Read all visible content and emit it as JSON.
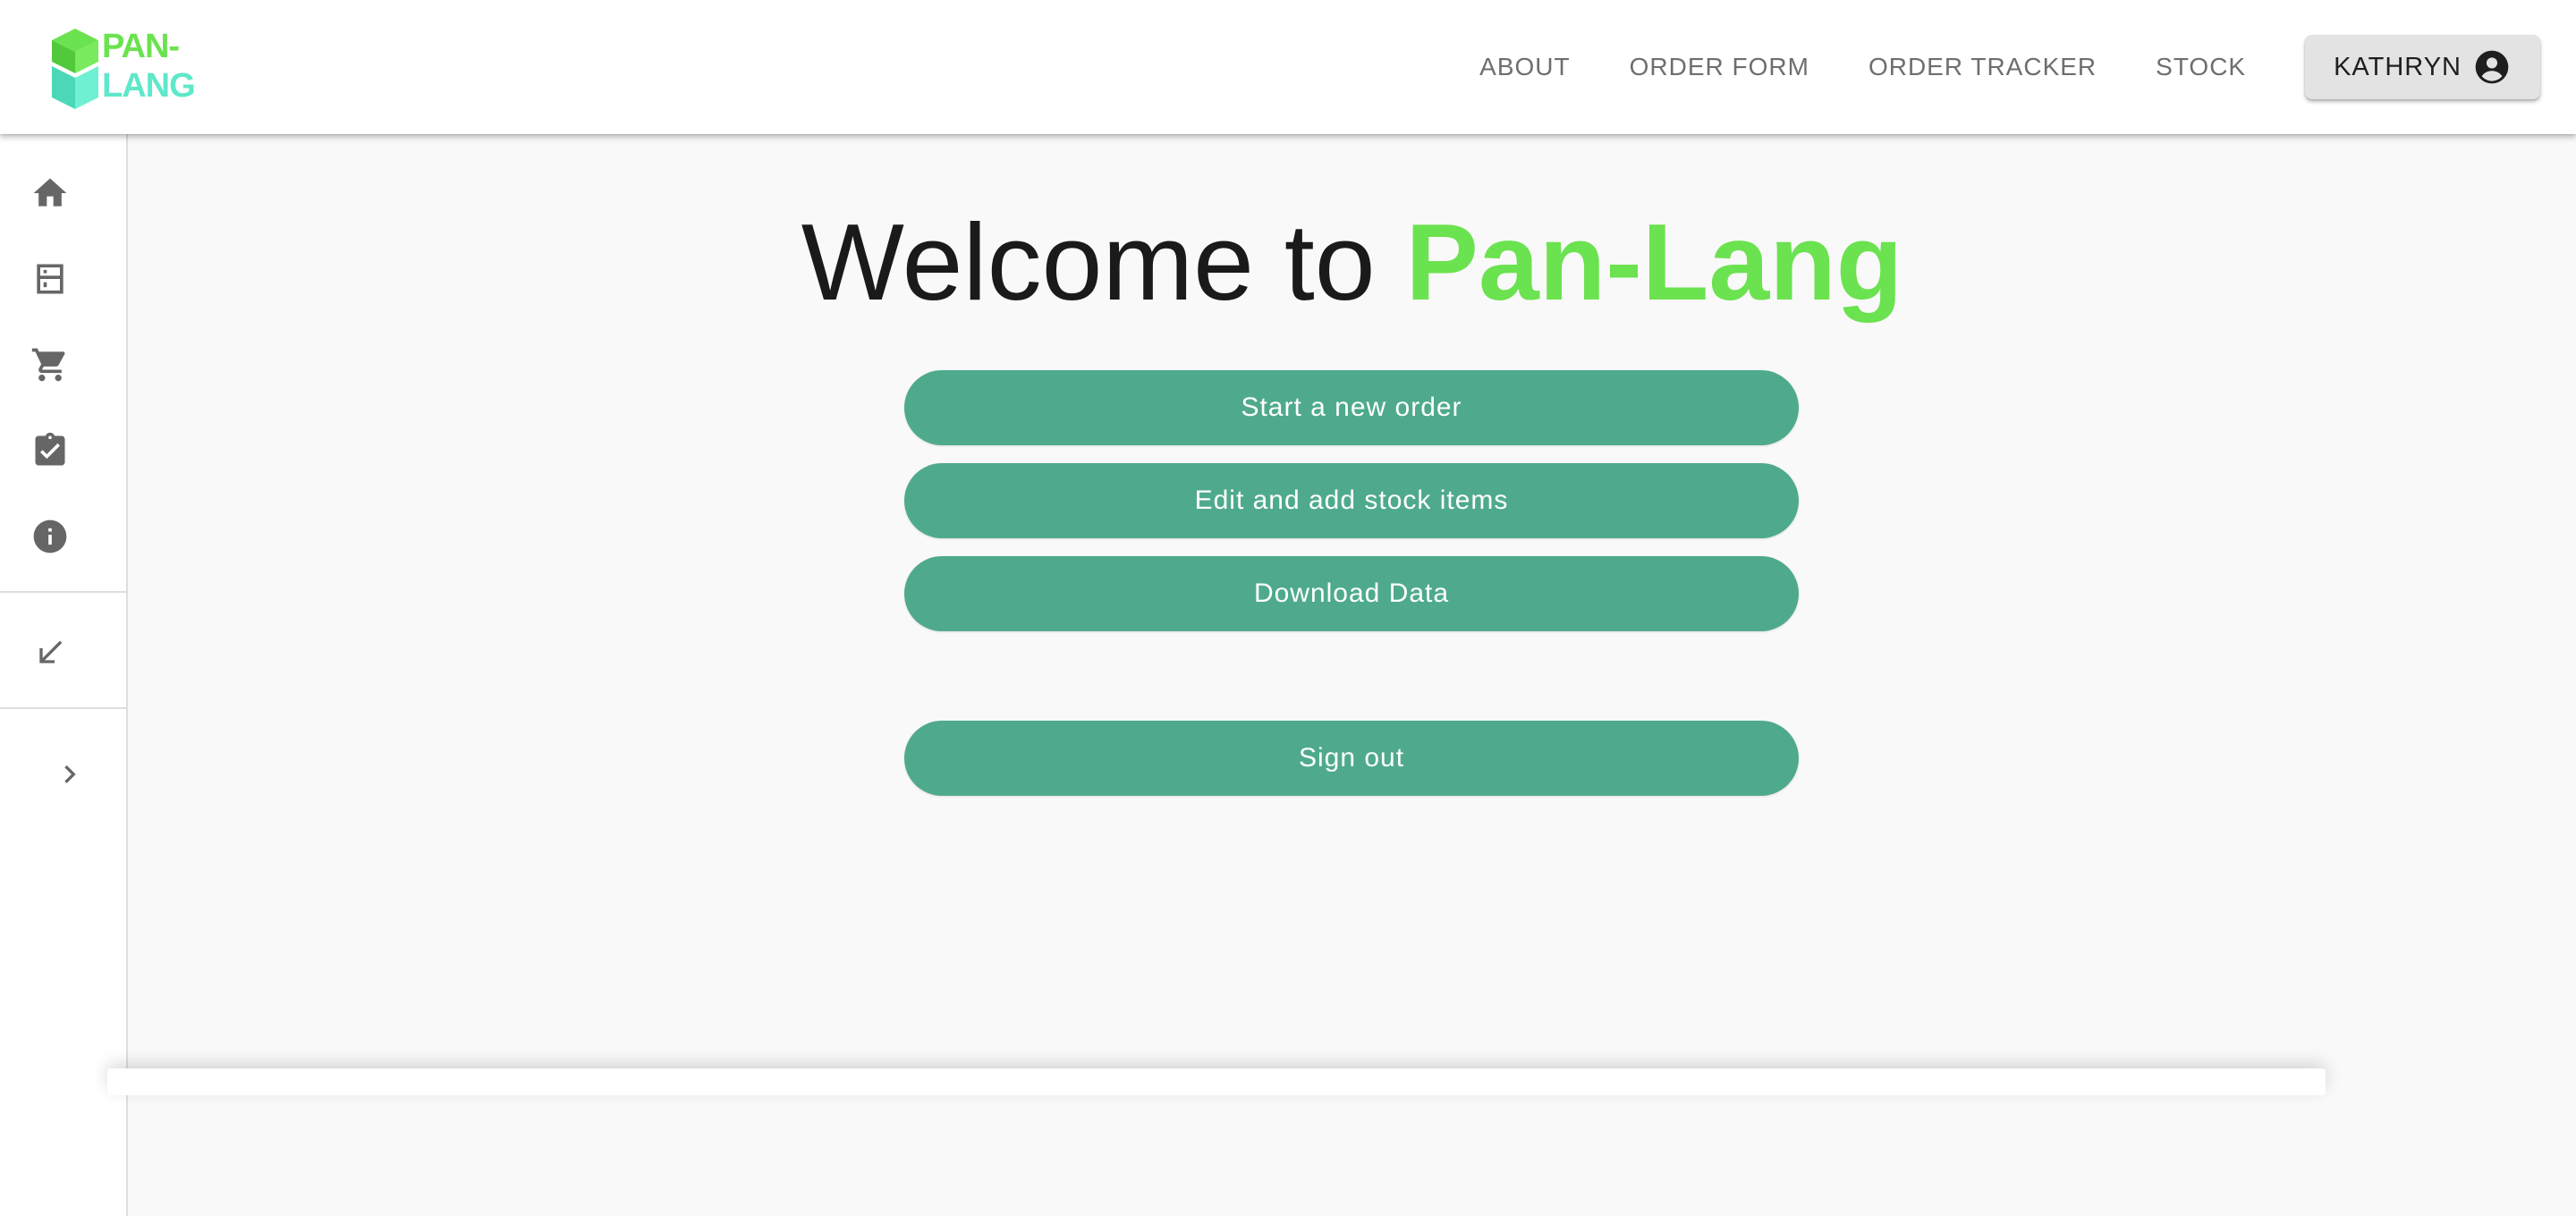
{
  "brand": {
    "logo_line1": "PAN-",
    "logo_line2": "LANG",
    "logo_colors": {
      "top": "#6be24f",
      "bottom": "#5ee8c9"
    }
  },
  "topnav": {
    "links": [
      "ABOUT",
      "ORDER FORM",
      "ORDER TRACKER",
      "STOCK"
    ],
    "user_label": "KATHRYN",
    "user_icon": "account-circle-icon"
  },
  "siderail": {
    "items": [
      {
        "name": "home",
        "icon": "home-icon"
      },
      {
        "name": "order-form",
        "icon": "order-form-icon"
      },
      {
        "name": "cart",
        "icon": "cart-icon"
      },
      {
        "name": "tracker",
        "icon": "clipboard-check-icon"
      },
      {
        "name": "about",
        "icon": "info-icon"
      },
      {
        "name": "collapse",
        "icon": "arrow-down-left-icon"
      },
      {
        "name": "expand",
        "icon": "chevron-right-icon"
      }
    ]
  },
  "main": {
    "welcome_text": "Welcome to",
    "brand_text": "Pan-Lang",
    "buttons": {
      "new_order": "Start a new order",
      "stock_items": "Edit and add stock items",
      "download": "Download Data",
      "sign_out": "Sign out"
    }
  },
  "colors": {
    "accent_green": "#6be24f",
    "button_teal": "#4faa8d",
    "background": "#f9f9f9"
  }
}
